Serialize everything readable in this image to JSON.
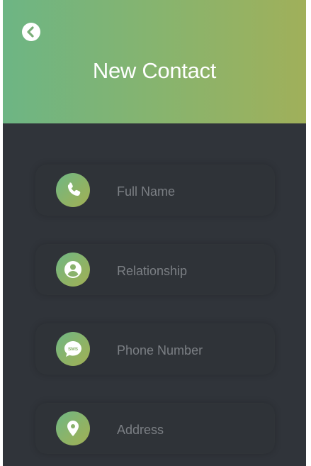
{
  "header": {
    "title": "New Contact",
    "back_icon": "back-chevron-icon"
  },
  "colors": {
    "gradient_start": "#6db584",
    "gradient_end": "#a0b05a",
    "background": "#30343a",
    "field_text": "#7b7f84"
  },
  "form": {
    "fields": [
      {
        "placeholder": "Full Name",
        "icon": "phone-icon"
      },
      {
        "placeholder": "Relationship",
        "icon": "person-icon"
      },
      {
        "placeholder": "Phone Number",
        "icon": "sms-icon"
      },
      {
        "placeholder": "Address",
        "icon": "location-pin-icon"
      }
    ],
    "sms_icon_text": "SMS"
  }
}
